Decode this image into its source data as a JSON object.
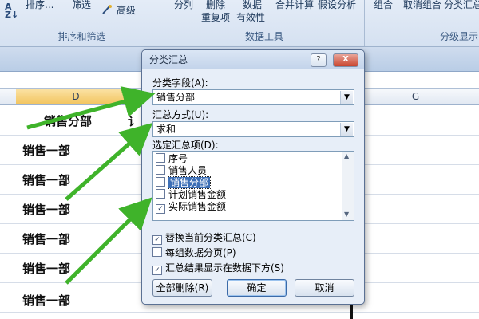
{
  "ribbon": {
    "sort_label": "排序...",
    "filter_label": "筛选",
    "advanced_label": "高级",
    "sort_filter_group": "排序和筛选",
    "split_label": "分列",
    "remove_dup_label": "删除",
    "remove_dup_label2": "重复项",
    "validation_label": "数据",
    "validation_label2": "有效性",
    "consolidate_label": "合并计算",
    "whatif_label": "假设分析",
    "data_tools_group": "数据工具",
    "group_label": "组合",
    "ungroup_label": "取消组合",
    "subtotal_label": "分类汇总",
    "outline_group": "分级显示"
  },
  "sheet": {
    "col_d": "D",
    "col_g": "G",
    "header_cell": "销售分部",
    "header_partial": "讠",
    "rows": [
      "销售一部",
      "销售一部",
      "销售一部",
      "销售一部",
      "销售一部",
      "销售一部"
    ]
  },
  "dialog": {
    "title": "分类汇总",
    "help_btn": "?",
    "close_btn": "X",
    "group_by_label": "分类字段(A):",
    "group_by_value": "销售分部",
    "function_label": "汇总方式(U):",
    "function_value": "求和",
    "subtotal_items_label": "选定汇总项(D):",
    "items": [
      {
        "label": "序号",
        "checked": false,
        "selected": false
      },
      {
        "label": "销售人员",
        "checked": false,
        "selected": false
      },
      {
        "label": "销售分部",
        "checked": false,
        "selected": true
      },
      {
        "label": "计划销售金额",
        "checked": false,
        "selected": false
      },
      {
        "label": "实际销售金额",
        "checked": true,
        "selected": false
      }
    ],
    "options": [
      {
        "label": "替换当前分类汇总(C)",
        "checked": true
      },
      {
        "label": "每组数据分页(P)",
        "checked": false
      },
      {
        "label": "汇总结果显示在数据下方(S)",
        "checked": true
      }
    ],
    "remove_all_btn": "全部删除(R)",
    "ok_btn": "确定",
    "cancel_btn": "取消"
  },
  "colors": {
    "accent_selection": "#3d6fb6",
    "arrow_green": "#3fb32a"
  }
}
